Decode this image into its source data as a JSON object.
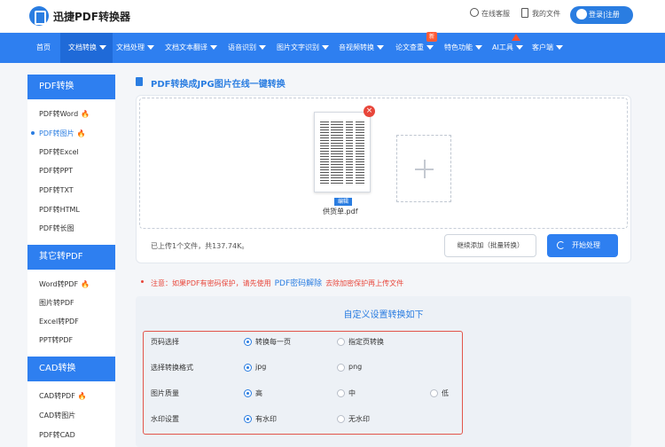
{
  "header": {
    "logo_text": "迅捷PDF转换器",
    "customer_service": "在线客服",
    "my_files": "我的文件",
    "login": "登录|注册"
  },
  "nav": {
    "items": [
      "首页",
      "文档转换",
      "文档处理",
      "文档文本翻译",
      "语音识别",
      "图片文字识别",
      "音视频转换",
      "论文查重",
      "特色功能",
      "AI工具",
      "客户端"
    ],
    "badge": "新",
    "active_index": 1
  },
  "sidebar": {
    "sections": [
      {
        "title": "PDF转换",
        "items": [
          "PDF转Word",
          "PDF转图片",
          "PDF转Excel",
          "PDF转PPT",
          "PDF转TXT",
          "PDF转HTML",
          "PDF转长图"
        ]
      },
      {
        "title": "其它转PDF",
        "items": [
          "Word转PDF",
          "图片转PDF",
          "Excel转PDF",
          "PPT转PDF"
        ]
      },
      {
        "title": "CAD转换",
        "items": [
          "CAD转PDF",
          "CAD转图片",
          "PDF转CAD"
        ]
      }
    ],
    "active_item": "PDF转图片"
  },
  "main": {
    "title": "PDF转换成JPG图片在线一键转换",
    "file": {
      "name": "供货单.pdf",
      "edit_label": "编辑"
    },
    "upload_info": "已上传1个文件，共137.74K。",
    "continue_btn": "继续添加（批量转换）",
    "start_btn": "开始处理",
    "notice_prefix": "注意：如果PDF有密码保护，请先使用",
    "notice_link": "PDF密码解除",
    "notice_suffix": "去除加密保护再上传文件"
  },
  "settings": {
    "title": "自定义设置转换如下",
    "rows": [
      {
        "label": "页码选择",
        "options": [
          "转换每一页",
          "指定页转换"
        ],
        "selected": 0
      },
      {
        "label": "选择转换格式",
        "options": [
          "jpg",
          "png"
        ],
        "selected": 0
      },
      {
        "label": "图片质量",
        "options": [
          "高",
          "中",
          "低"
        ],
        "selected": 0
      },
      {
        "label": "水印设置",
        "options": [
          "有水印",
          "无水印"
        ],
        "selected": 0
      }
    ]
  },
  "colors": {
    "primary": "#2e7ff0",
    "accent_red": "#e8463a",
    "fire": "#ff6d1f"
  }
}
